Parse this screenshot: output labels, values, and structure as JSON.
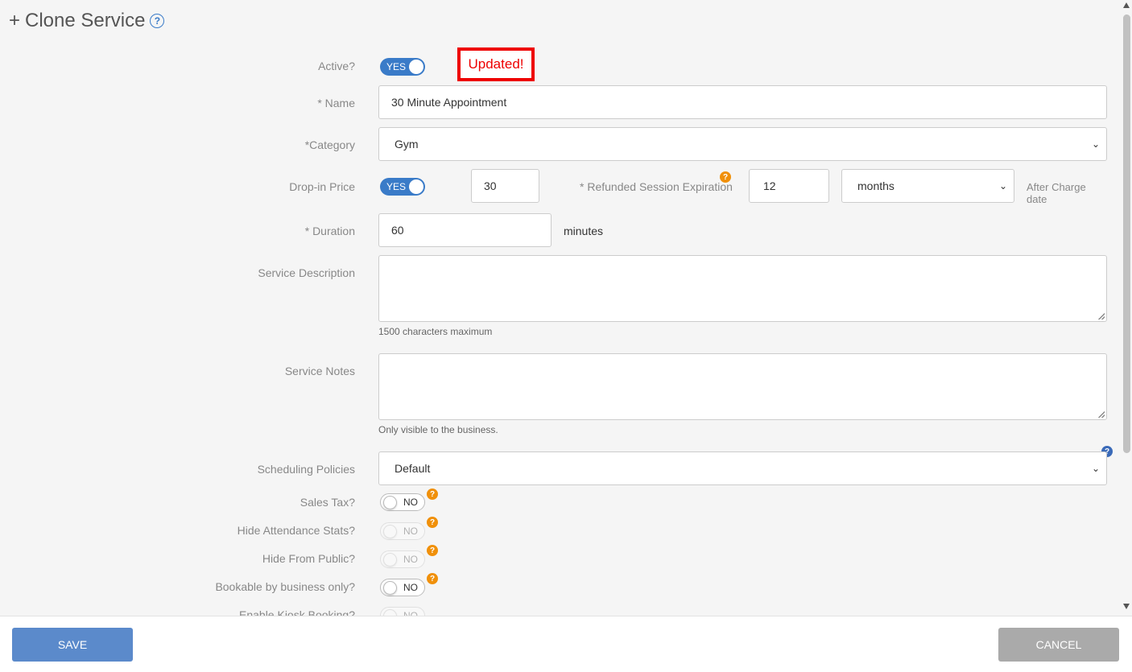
{
  "title": {
    "plus": "+",
    "text": "Clone Service",
    "help": "?"
  },
  "badge": "Updated!",
  "fields": {
    "active": {
      "label": "Active?",
      "toggle": "YES"
    },
    "name": {
      "label": "* Name",
      "value": "30 Minute Appointment"
    },
    "category": {
      "label": "*Category",
      "value": "Gym"
    },
    "dropin": {
      "label": "Drop-in Price",
      "toggle": "YES",
      "price": "30"
    },
    "refund": {
      "label": "* Refunded Session Expiration",
      "value": "12",
      "unit": "months",
      "after": "After Charge date"
    },
    "duration": {
      "label": "* Duration",
      "value": "60",
      "unit": "minutes"
    },
    "description": {
      "label": "Service Description",
      "hint": "1500 characters maximum"
    },
    "notes": {
      "label": "Service Notes",
      "hint": "Only visible to the business."
    },
    "scheduling": {
      "label": "Scheduling Policies",
      "value": "Default"
    },
    "sales_tax": {
      "label": "Sales Tax?",
      "toggle": "NO"
    },
    "hide_attendance": {
      "label": "Hide Attendance Stats?",
      "toggle": "NO"
    },
    "hide_public": {
      "label": "Hide From Public?",
      "toggle": "NO"
    },
    "bookable": {
      "label": "Bookable by business only?",
      "toggle": "NO"
    },
    "kiosk": {
      "label": "Enable Kiosk Booking?",
      "toggle": "NO"
    }
  },
  "footer": {
    "save": "SAVE",
    "cancel": "CANCEL"
  },
  "colors": {
    "primary": "#3a7bc8",
    "save": "#5b8acb",
    "cancel": "#aaaaaa",
    "badge": "#ee0000",
    "help": "#f0900a"
  }
}
